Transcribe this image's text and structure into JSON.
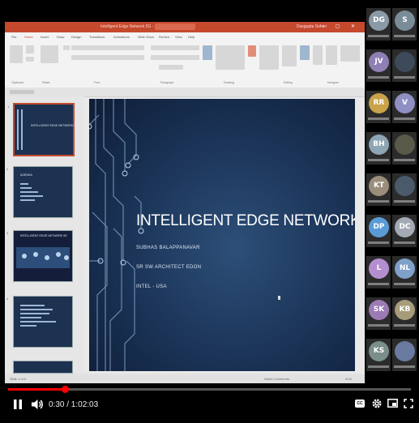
{
  "powerpoint": {
    "window_title": "Intelligent Edge Network 5G - PowerPoint",
    "search_placeholder": "Search",
    "user_name": "Dasgupta Sohini",
    "tabs": [
      "File",
      "Home",
      "Insert",
      "Draw",
      "Design",
      "Transitions",
      "Animations",
      "Slide Show",
      "Review",
      "View",
      "Help"
    ],
    "status_left": "Slide 1 of 5",
    "status_right": "Notes   Comments",
    "zoom": "91%"
  },
  "slide": {
    "title": "INTELLIGENT EDGE NETWORK 5G",
    "lines": [
      "SUBHAS BALAPPANAVAR",
      "SR SW ARCHITECT EDON",
      "INTEL - USA"
    ]
  },
  "thumbnails": [
    {
      "number": "1",
      "title": "INTELLIGENT EDGE NETWORK 5G",
      "selected": true
    },
    {
      "number": "2",
      "title": "AGENDA",
      "selected": false
    },
    {
      "number": "3",
      "title": "INTELLIGENT EDGE NETWORK 5G",
      "selected": false
    },
    {
      "number": "4",
      "title": "",
      "selected": false
    }
  ],
  "participants": [
    {
      "initials": "DG",
      "color": "#8a9aa6"
    },
    {
      "initials": "S",
      "color": "#7a8c98"
    },
    {
      "initials": "JV",
      "color": "#8e7fb5"
    },
    {
      "initials": "",
      "color": "#3c4a5a",
      "icon": "person-photo-icon"
    },
    {
      "initials": "RR",
      "color": "#c9a24a"
    },
    {
      "initials": "V",
      "color": "#8f8fc4"
    },
    {
      "initials": "BH",
      "color": "#8ea5b5"
    },
    {
      "initials": "",
      "color": "#5a5a4a",
      "icon": "person-photo-icon"
    },
    {
      "initials": "KT",
      "color": "#9a8e7a"
    },
    {
      "initials": "",
      "color": "#4a5a6a",
      "icon": "person-photo-icon"
    },
    {
      "initials": "DP",
      "color": "#5b9bd5"
    },
    {
      "initials": "DC",
      "color": "#a3aab4"
    },
    {
      "initials": "L",
      "color": "#b48fd0"
    },
    {
      "initials": "NL",
      "color": "#7fa0c8"
    },
    {
      "initials": "SK",
      "color": "#9c7bb5"
    },
    {
      "initials": "KB",
      "color": "#a79c7a"
    },
    {
      "initials": "KS",
      "color": "#7a8e8a"
    },
    {
      "initials": "",
      "color": "#6a7aa0",
      "icon": "person-icon"
    }
  ],
  "player": {
    "time": "0:30 / 1:02:03",
    "progress": 0.14,
    "cc_label": "CC"
  },
  "icons": {
    "play_pause": "pause-icon",
    "volume": "volume-icon",
    "settings": "gear-icon",
    "miniplayer": "miniplayer-icon",
    "fullscreen": "fullscreen-icon"
  }
}
